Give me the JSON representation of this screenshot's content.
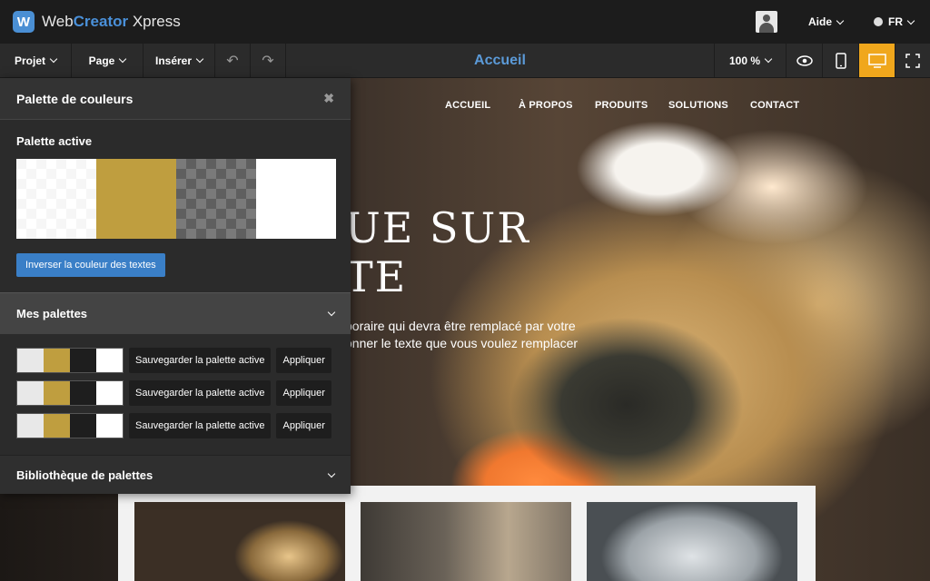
{
  "app": {
    "logo_letter": "W",
    "brand_part1": "Web",
    "brand_part2": "Creator",
    "brand_part3": " Xpress",
    "help_label": "Aide",
    "lang_label": "FR"
  },
  "toolbar": {
    "project": "Projet",
    "page": "Page",
    "insert": "Insérer",
    "undo_icon": "↶",
    "redo_icon": "↷",
    "current_page": "Accueil",
    "zoom": "100 %",
    "desktop_active": true
  },
  "site": {
    "nav": [
      "ACCUEIL",
      "À PROPOS",
      "PRODUITS",
      "SOLUTIONS",
      "CONTACT"
    ],
    "hero_line1": "UE SUR",
    "hero_line2": "TE",
    "text_line1": "poraire qui devra être remplacé par votre",
    "text_line2": "onner le texte que vous voulez remplacer"
  },
  "panel": {
    "title": "Palette de couleurs",
    "close": "✖",
    "active_label": "Palette active",
    "active_colors": [
      "#ffffff",
      "#bf9e3f",
      "#666666",
      "#ffffff"
    ],
    "invert_button": "Inverser la couleur des textes",
    "my_palettes_label": "Mes palettes",
    "save_label": "Sauvegarder la palette active",
    "apply_label": "Appliquer",
    "saved_palettes": [
      [
        "#e8e8e8",
        "#bf9e3f",
        "#1e1e1e",
        "#ffffff"
      ],
      [
        "#e8e8e8",
        "#bf9e3f",
        "#1e1e1e",
        "#ffffff"
      ],
      [
        "#e8e8e8",
        "#bf9e3f",
        "#1e1e1e",
        "#ffffff"
      ]
    ],
    "library_label": "Bibliothèque de palettes"
  },
  "colors": {
    "accent_blue": "#4a90d9",
    "active_orange": "#f0a71c",
    "button_blue": "#3a7fc7"
  }
}
